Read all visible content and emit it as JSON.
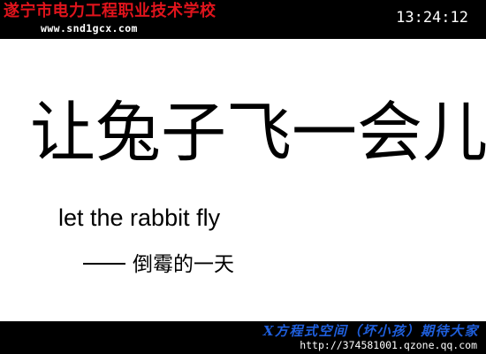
{
  "header": {
    "school_name": "遂宁市电力工程职业技术学校",
    "school_url": "www.snd1gcx.com",
    "clock": "13:24:12"
  },
  "slide": {
    "title": "让兔子飞一会儿",
    "subtitle": "let the rabbit fly",
    "byline": "倒霉的一天"
  },
  "footer": {
    "space_name": "X方程式空间（坏小孩）期待大家",
    "space_url": "http://374581001.qzone.qq.com"
  },
  "colors": {
    "bar_background": "#000000",
    "school_name": "#e0141c",
    "space_name": "#1f5fdc",
    "slide_background": "#ffffff",
    "text": "#000000"
  }
}
